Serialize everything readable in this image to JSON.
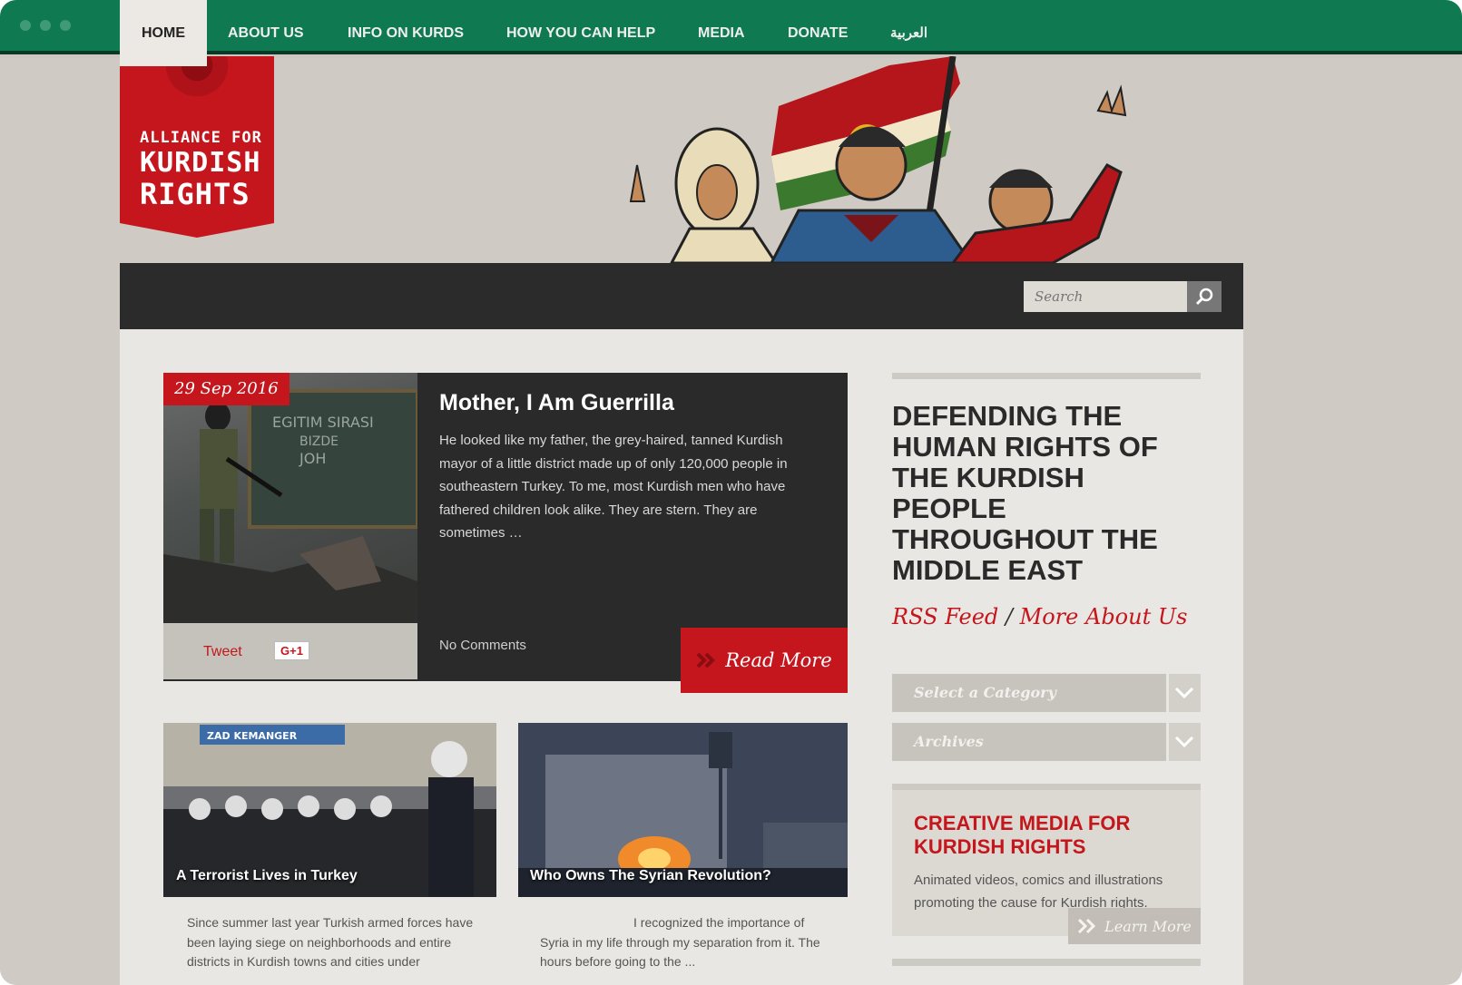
{
  "site": {
    "logo": {
      "line1": "ALLIANCE FOR",
      "line2": "KURDISH",
      "line3": "RIGHTS"
    }
  },
  "nav": {
    "items": [
      {
        "label": "HOME",
        "active": true
      },
      {
        "label": "ABOUT US"
      },
      {
        "label": "INFO ON KURDS"
      },
      {
        "label": "HOW YOU CAN HELP"
      },
      {
        "label": "MEDIA"
      },
      {
        "label": "DONATE"
      },
      {
        "label": "العربية"
      }
    ],
    "search_placeholder": "Search"
  },
  "featured": {
    "date": "29 Sep 2016",
    "title": "Mother, I Am Guerrilla",
    "excerpt": "He looked like my father, the grey-haired, tanned Kurdish mayor of a little district made up of only 120,000 people in southeastern Turkey. To me, most Kurdish men who have fathered children look alike. They are stern. They are sometimes …",
    "comments": "No Comments",
    "read_more": "Read More",
    "share": {
      "tweet": "Tweet",
      "gplus": "G+1"
    },
    "image_text": [
      "EGITIM SIRASI",
      "BIZDE",
      "JOH"
    ]
  },
  "posts": [
    {
      "title": "A Terrorist Lives in Turkey",
      "excerpt": "Since summer last year Turkish armed forces have been laying siege on neighborhoods and entire districts in Kurdish towns and cities under",
      "sign": "ZAD KEMANGER"
    },
    {
      "title": "Who Owns The Syrian Revolution?",
      "excerpt": "I recognized the importance of Syria in my life through my separation from it. The hours before going to the ..."
    }
  ],
  "sidebar": {
    "tagline": "DEFENDING THE HUMAN RIGHTS OF THE KURDISH PEOPLE THROUGHOUT THE MIDDLE EAST",
    "rss": "RSS Feed",
    "separator": "/",
    "more_about": "More About Us",
    "category_select": "Select a Category",
    "archives_select": "Archives",
    "creative": {
      "title": "CREATIVE MEDIA FOR KURDISH RIGHTS",
      "text": "Animated videos, comics and illustrations promoting the cause for Kurdish rights.",
      "learn_more": "Learn More"
    }
  },
  "colors": {
    "titlebar": "#0f7a52",
    "brand_red": "#c4161c",
    "nav_dark": "#2b2b2b",
    "page_bg": "#cfcbc4",
    "panel_bg": "#e9e7e3"
  }
}
